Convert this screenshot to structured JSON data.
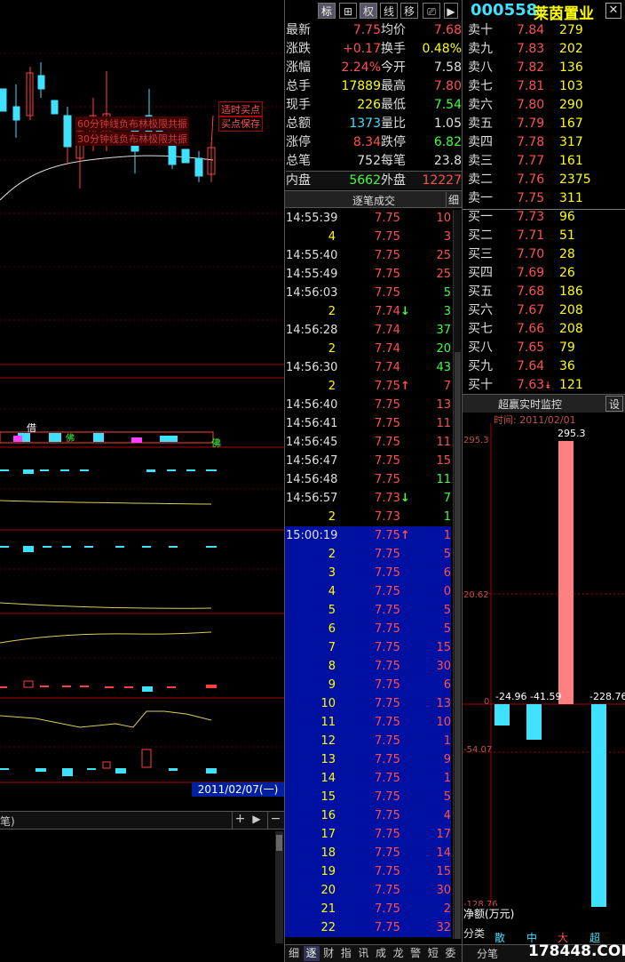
{
  "toolbar": {
    "btn1": "标",
    "btn2": "⊞",
    "btn3": "权",
    "btn4": "线",
    "btn5": "移",
    "btn6": "⎚",
    "btn7": "▶",
    "code": "000558",
    "name": "莱茵置业",
    "close": "✕"
  },
  "annotations": {
    "buy_title": "适时买点",
    "buy_sub": "买点保存",
    "sig1": "60分钟线负布林极限共振",
    "sig2": "30分钟线负布林极限共振",
    "tag1": "借",
    "tag2": "佛",
    "tag3": "佛"
  },
  "chart": {
    "date_label": "2011/02/07(一)",
    "bottom_tab": "笔)",
    "btn_plus": "+",
    "btn_next": "▶",
    "btn_minus": "−"
  },
  "quote": [
    {
      "l1": "最新",
      "v1": "7.75",
      "l2": "均价",
      "v2": "7.68",
      "c1": "red",
      "c2": "red"
    },
    {
      "l1": "涨跌",
      "v1": "+0.17",
      "l2": "换手",
      "v2": "0.48%",
      "c1": "red",
      "c2": "yel"
    },
    {
      "l1": "涨幅",
      "v1": "2.24%",
      "l2": "今开",
      "v2": "7.58",
      "c1": "red",
      "c2": "wht"
    },
    {
      "l1": "总手",
      "v1": "17889",
      "l2": "最高",
      "v2": "7.80",
      "c1": "yel",
      "c2": "red"
    },
    {
      "l1": "现手",
      "v1": "226",
      "l2": "最低",
      "v2": "7.54",
      "c1": "yel",
      "c2": "grn"
    },
    {
      "l1": "总额",
      "v1": "1373",
      "l2": "量比",
      "v2": "1.05",
      "c1": "cyn",
      "c2": "wht"
    },
    {
      "l1": "涨停",
      "v1": "8.34",
      "l2": "跌停",
      "v2": "6.82",
      "c1": "red",
      "c2": "grn"
    },
    {
      "l1": "总笔",
      "v1": "752",
      "l2": "每笔",
      "v2": "23.8",
      "c1": "wht",
      "c2": "wht"
    },
    {
      "l1": "内盘",
      "v1": "5662",
      "l2": "外盘",
      "v2": "12227",
      "c1": "grn",
      "c2": "red"
    }
  ],
  "sell": [
    {
      "l": "卖十",
      "p": "7.84",
      "v": "279"
    },
    {
      "l": "卖九",
      "p": "7.83",
      "v": "202"
    },
    {
      "l": "卖八",
      "p": "7.82",
      "v": "136"
    },
    {
      "l": "卖七",
      "p": "7.81",
      "v": "103"
    },
    {
      "l": "卖六",
      "p": "7.80",
      "v": "290"
    },
    {
      "l": "卖五",
      "p": "7.79",
      "v": "167"
    },
    {
      "l": "卖四",
      "p": "7.78",
      "v": "317"
    },
    {
      "l": "卖三",
      "p": "7.77",
      "v": "161"
    },
    {
      "l": "卖二",
      "p": "7.76",
      "v": "2375"
    },
    {
      "l": "卖一",
      "p": "7.75",
      "v": "311"
    }
  ],
  "buy": [
    {
      "l": "买一",
      "p": "7.73",
      "v": "96"
    },
    {
      "l": "买二",
      "p": "7.71",
      "v": "51"
    },
    {
      "l": "买三",
      "p": "7.70",
      "v": "28"
    },
    {
      "l": "买四",
      "p": "7.69",
      "v": "26"
    },
    {
      "l": "买五",
      "p": "7.68",
      "v": "186"
    },
    {
      "l": "买六",
      "p": "7.67",
      "v": "208"
    },
    {
      "l": "买七",
      "p": "7.66",
      "v": "208"
    },
    {
      "l": "买八",
      "p": "7.65",
      "v": "79"
    },
    {
      "l": "买九",
      "p": "7.64",
      "v": "36"
    },
    {
      "l": "买十",
      "p": "7.63",
      "v": "121",
      "arrow": "⯯"
    }
  ],
  "trades_header": {
    "title": "逐笔成交",
    "btn": "细"
  },
  "trades": [
    {
      "t": "14:55:39",
      "p": "7.75",
      "v": "10",
      "vc": "red"
    },
    {
      "t": "4",
      "p": "7.75",
      "v": "3",
      "vc": "red"
    },
    {
      "t": "14:55:40",
      "p": "7.75",
      "v": "25",
      "vc": "red"
    },
    {
      "t": "14:55:49",
      "p": "7.75",
      "v": "25",
      "vc": "red"
    },
    {
      "t": "14:56:03",
      "p": "7.75",
      "v": "5",
      "vc": "grn"
    },
    {
      "t": "2",
      "p": "7.74",
      "a": "↓",
      "ac": "grn",
      "v": "3",
      "vc": "grn"
    },
    {
      "t": "14:56:28",
      "p": "7.74",
      "v": "37",
      "vc": "grn"
    },
    {
      "t": "2",
      "p": "7.74",
      "v": "20",
      "vc": "grn"
    },
    {
      "t": "14:56:30",
      "p": "7.74",
      "v": "43",
      "vc": "grn"
    },
    {
      "t": "2",
      "p": "7.75",
      "a": "↑",
      "ac": "red",
      "v": "7",
      "vc": "red"
    },
    {
      "t": "14:56:40",
      "p": "7.75",
      "v": "13",
      "vc": "red"
    },
    {
      "t": "14:56:41",
      "p": "7.75",
      "v": "11",
      "vc": "red"
    },
    {
      "t": "14:56:45",
      "p": "7.75",
      "v": "11",
      "vc": "red"
    },
    {
      "t": "14:56:47",
      "p": "7.75",
      "v": "15",
      "vc": "red"
    },
    {
      "t": "14:56:48",
      "p": "7.75",
      "v": "11",
      "vc": "grn"
    },
    {
      "t": "14:56:57",
      "p": "7.73",
      "a": "↓",
      "ac": "grn",
      "v": "7",
      "vc": "grn"
    },
    {
      "t": "2",
      "p": "7.73",
      "v": "1",
      "vc": "grn"
    }
  ],
  "trades_blue": [
    {
      "t": "15:00:19",
      "p": "7.75",
      "a": "↑",
      "v": "1"
    },
    {
      "t": "2",
      "p": "7.75",
      "v": "5"
    },
    {
      "t": "3",
      "p": "7.75",
      "v": "6"
    },
    {
      "t": "4",
      "p": "7.75",
      "v": "0"
    },
    {
      "t": "5",
      "p": "7.75",
      "v": "5"
    },
    {
      "t": "6",
      "p": "7.75",
      "v": "5"
    },
    {
      "t": "7",
      "p": "7.75",
      "v": "15"
    },
    {
      "t": "8",
      "p": "7.75",
      "v": "30"
    },
    {
      "t": "9",
      "p": "7.75",
      "v": "6"
    },
    {
      "t": "10",
      "p": "7.75",
      "v": "13"
    },
    {
      "t": "11",
      "p": "7.75",
      "v": "10"
    },
    {
      "t": "12",
      "p": "7.75",
      "v": "1"
    },
    {
      "t": "13",
      "p": "7.75",
      "v": "9"
    },
    {
      "t": "14",
      "p": "7.75",
      "v": "1"
    },
    {
      "t": "15",
      "p": "7.75",
      "v": "5"
    },
    {
      "t": "16",
      "p": "7.75",
      "v": "4"
    },
    {
      "t": "17",
      "p": "7.75",
      "v": "17"
    },
    {
      "t": "18",
      "p": "7.75",
      "v": "14"
    },
    {
      "t": "19",
      "p": "7.75",
      "v": "15"
    },
    {
      "t": "20",
      "p": "7.75",
      "v": "30"
    },
    {
      "t": "21",
      "p": "7.75",
      "v": "2"
    },
    {
      "t": "22",
      "p": "7.75",
      "v": "32"
    }
  ],
  "monitor": {
    "title": "超赢实时监控",
    "btn": "设",
    "time": "时间: 2011/02/01",
    "top_val": "295.3",
    "axis1": "295.3",
    "axis2": "20.62",
    "axis3": "0",
    "axis4": "-54.07",
    "axis5": "-128.76",
    "lbl1": "-24.96",
    "lbl2": "-41.59",
    "lbl3": "295.3",
    "lbl4": "-228.76",
    "net": "净额(万元)",
    "cat": "分类",
    "cats": [
      "散户",
      "中户",
      "大户",
      "超大"
    ]
  },
  "bottom_tabs": [
    "细",
    "逐",
    "财",
    "指",
    "讯",
    "成",
    "龙",
    "警",
    "短",
    "委"
  ],
  "bottom_right": {
    "tab": "分笔",
    "site": "178448.COM"
  }
}
